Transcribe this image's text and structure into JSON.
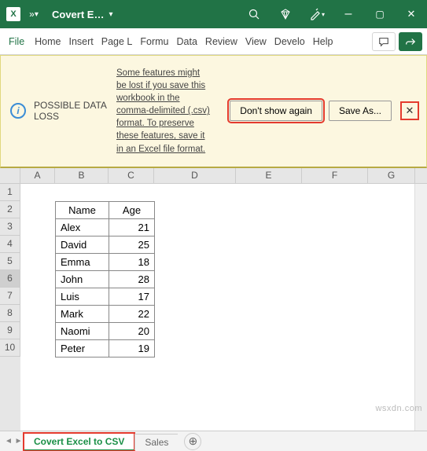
{
  "titlebar": {
    "app_letter": "X",
    "autosave": "»",
    "doc_title": "Covert E…"
  },
  "ribbon": {
    "tabs": [
      "File",
      "Home",
      "Insert",
      "Page L",
      "Formu",
      "Data",
      "Review",
      "View",
      "Develo",
      "Help"
    ]
  },
  "msgbar": {
    "title": "POSSIBLE DATA LOSS",
    "body": "Some features might be lost if you save this workbook in the comma-delimited (.csv) format. To preserve these features, save it in an Excel file format.",
    "dont": "Don't show again",
    "saveas": "Save As..."
  },
  "columns": [
    "A",
    "B",
    "C",
    "D",
    "E",
    "F",
    "G"
  ],
  "rows": [
    "1",
    "2",
    "3",
    "4",
    "5",
    "6",
    "7",
    "8",
    "9",
    "10"
  ],
  "selected_row": "6",
  "table": {
    "headers": {
      "name": "Name",
      "age": "Age"
    },
    "data": [
      {
        "name": "Alex",
        "age": "21"
      },
      {
        "name": "David",
        "age": "25"
      },
      {
        "name": "Emma",
        "age": "18"
      },
      {
        "name": "John",
        "age": "28"
      },
      {
        "name": "Luis",
        "age": "17"
      },
      {
        "name": "Mark",
        "age": "22"
      },
      {
        "name": "Naomi",
        "age": "20"
      },
      {
        "name": "Peter",
        "age": "19"
      }
    ]
  },
  "sheets": {
    "active": "Covert Excel to CSV",
    "others": [
      "Sales"
    ]
  },
  "watermark": "wsxdn.com"
}
